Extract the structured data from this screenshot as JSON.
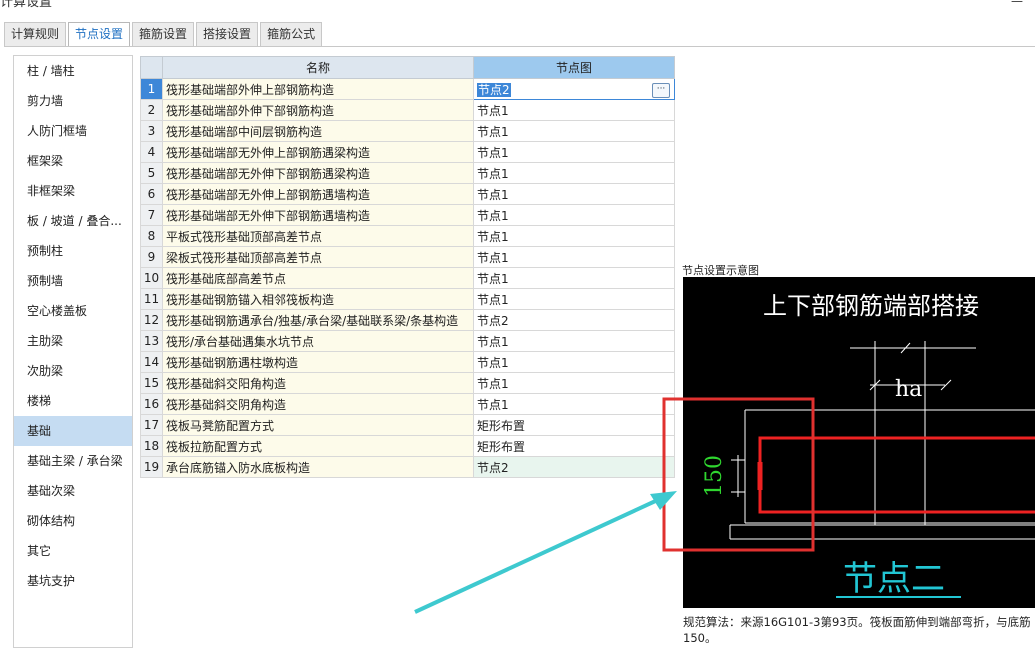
{
  "window": {
    "title": "计算设置"
  },
  "tabs": [
    {
      "label": "计算规则"
    },
    {
      "label": "节点设置"
    },
    {
      "label": "箍筋设置"
    },
    {
      "label": "搭接设置"
    },
    {
      "label": "箍筋公式"
    }
  ],
  "active_tab": "节点设置",
  "sidebar": {
    "items": [
      {
        "label": "柱 / 墙柱"
      },
      {
        "label": "剪力墙"
      },
      {
        "label": "人防门框墙"
      },
      {
        "label": "框架梁"
      },
      {
        "label": "非框架梁"
      },
      {
        "label": "板 / 坡道 / 叠合..."
      },
      {
        "label": "预制柱"
      },
      {
        "label": "预制墙"
      },
      {
        "label": "空心楼盖板"
      },
      {
        "label": "主肋梁"
      },
      {
        "label": "次肋梁"
      },
      {
        "label": "楼梯"
      },
      {
        "label": "基础"
      },
      {
        "label": "基础主梁 / 承台梁"
      },
      {
        "label": "基础次梁"
      },
      {
        "label": "砌体结构"
      },
      {
        "label": "其它"
      },
      {
        "label": "基坑支护"
      }
    ],
    "active": "基础"
  },
  "table": {
    "headers": {
      "name": "名称",
      "node": "节点图"
    },
    "rows": [
      {
        "no": "1",
        "name": "筏形基础端部外伸上部钢筋构造",
        "node": "节点2"
      },
      {
        "no": "2",
        "name": "筏形基础端部外伸下部钢筋构造",
        "node": "节点1"
      },
      {
        "no": "3",
        "name": "筏形基础端部中间层钢筋构造",
        "node": "节点1"
      },
      {
        "no": "4",
        "name": "筏形基础端部无外伸上部钢筋遇梁构造",
        "node": "节点1"
      },
      {
        "no": "5",
        "name": "筏形基础端部无外伸下部钢筋遇梁构造",
        "node": "节点1"
      },
      {
        "no": "6",
        "name": "筏形基础端部无外伸上部钢筋遇墙构造",
        "node": "节点1"
      },
      {
        "no": "7",
        "name": "筏形基础端部无外伸下部钢筋遇墙构造",
        "node": "节点1"
      },
      {
        "no": "8",
        "name": "平板式筏形基础顶部高差节点",
        "node": "节点1"
      },
      {
        "no": "9",
        "name": "梁板式筏形基础顶部高差节点",
        "node": "节点1"
      },
      {
        "no": "10",
        "name": "筏形基础底部高差节点",
        "node": "节点1"
      },
      {
        "no": "11",
        "name": "筏形基础钢筋锚入相邻筏板构造",
        "node": "节点1"
      },
      {
        "no": "12",
        "name": "筏形基础钢筋遇承台/独基/承台梁/基础联系梁/条基构造",
        "node": "节点2"
      },
      {
        "no": "13",
        "name": "筏形/承台基础遇集水坑节点",
        "node": "节点1"
      },
      {
        "no": "14",
        "name": "筏形基础钢筋遇柱墩构造",
        "node": "节点1"
      },
      {
        "no": "15",
        "name": "筏形基础斜交阳角构造",
        "node": "节点1"
      },
      {
        "no": "16",
        "name": "筏形基础斜交阴角构造",
        "node": "节点1"
      },
      {
        "no": "17",
        "name": "筏板马凳筋配置方式",
        "node": "矩形布置"
      },
      {
        "no": "18",
        "name": "筏板拉筋配置方式",
        "node": "矩形布置"
      },
      {
        "no": "19",
        "name": "承台底筋锚入防水底板构造",
        "node": "节点2"
      }
    ],
    "selected_row": 1,
    "ellipsis_label": "···"
  },
  "diagram": {
    "label": "节点设置示意图",
    "title": "上下部钢筋端部搭接",
    "dim_ha": "ha",
    "dim_150": "150",
    "caption": "节点二"
  },
  "description": {
    "line1": "规范算法：来源16G101-3第93页。筏板面筋伸到端部弯折，与底筋",
    "line2": "150。"
  },
  "colors": {
    "accent": "#1e6fc2",
    "selected_row": "#3d87d8",
    "name_cell_bg": "#fdfbea",
    "sidebar_active": "#c5dcf2",
    "highlight_box": "#e0312f",
    "arrow": "#3ec9cf",
    "dim_green": "#2fd62f",
    "caption_cyan": "#22c6d4"
  }
}
